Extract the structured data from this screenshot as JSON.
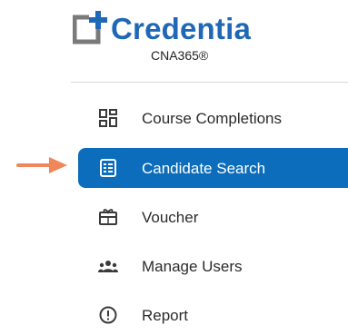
{
  "brand": {
    "name": "Credentia",
    "subtitle": "CNA365®",
    "color": "#1f68b6"
  },
  "nav": {
    "items": [
      {
        "label": "Course Completions",
        "icon": "grid-dashboard-icon",
        "active": false
      },
      {
        "label": "Candidate Search",
        "icon": "id-card-list-icon",
        "active": true
      },
      {
        "label": "Voucher",
        "icon": "ticket-voucher-icon",
        "active": false
      },
      {
        "label": "Manage Users",
        "icon": "users-group-icon",
        "active": false
      },
      {
        "label": "Report",
        "icon": "alert-circle-icon",
        "active": false
      }
    ],
    "active_color": "#0b6dbb"
  },
  "annotation": {
    "icon": "pointer-arrow-icon",
    "color": "#f0875a"
  }
}
